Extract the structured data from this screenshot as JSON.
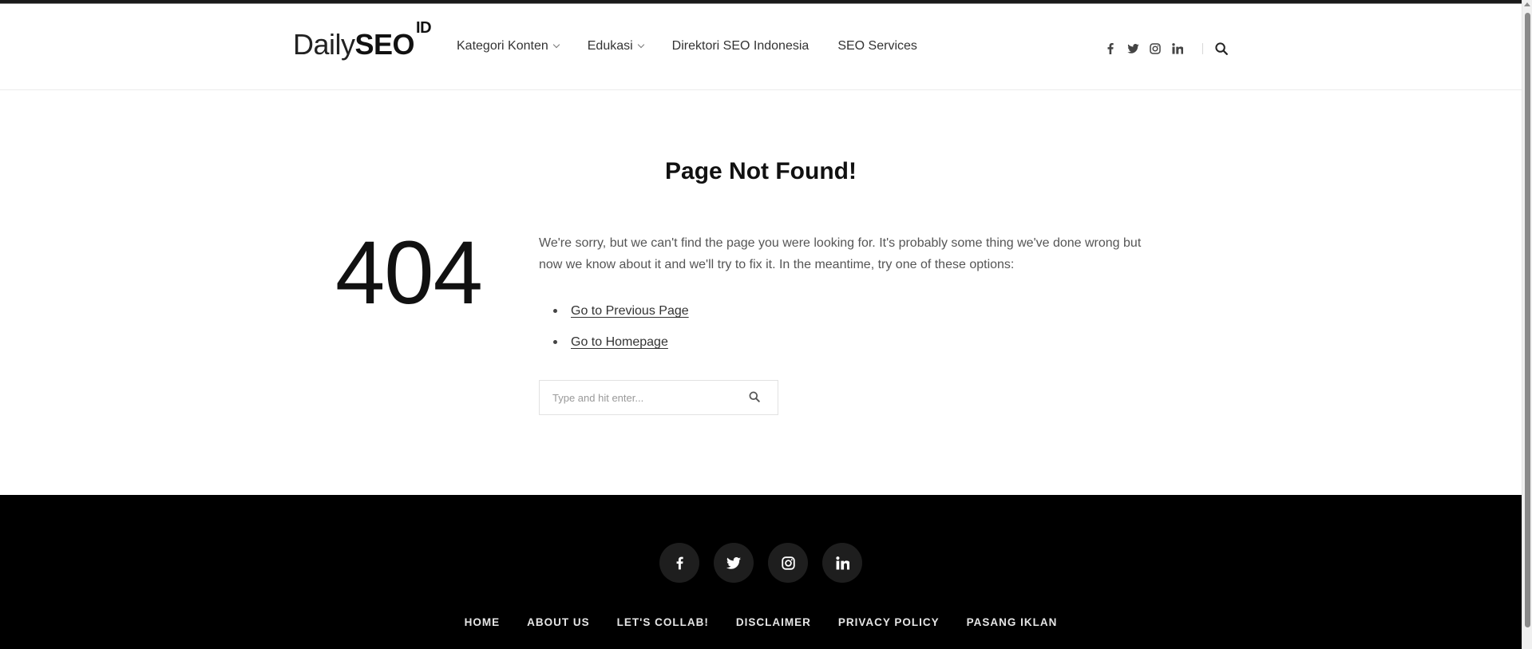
{
  "brand": {
    "logo_part1": "Daily",
    "logo_part2": "SEO",
    "logo_sup": "ID"
  },
  "nav": {
    "items": [
      {
        "label": "Kategori Konten",
        "has_dropdown": true
      },
      {
        "label": "Edukasi",
        "has_dropdown": true
      },
      {
        "label": "Direktori SEO Indonesia",
        "has_dropdown": false
      },
      {
        "label": "SEO Services",
        "has_dropdown": false
      }
    ]
  },
  "header_social": [
    "facebook-icon",
    "twitter-icon",
    "instagram-icon",
    "linkedin-icon"
  ],
  "content": {
    "title": "Page Not Found!",
    "code": "404",
    "message": "We're sorry, but we can't find the page you were looking for. It's probably some thing we've done wrong but now we know about it and we'll try to fix it. In the meantime, try one of these options:",
    "options": [
      "Go to Previous Page",
      "Go to Homepage"
    ],
    "search_placeholder": "Type and hit enter..."
  },
  "footer": {
    "social": [
      "facebook-icon",
      "twitter-icon",
      "instagram-icon",
      "linkedin-icon"
    ],
    "menu": [
      "HOME",
      "ABOUT US",
      "LET'S COLLAB!",
      "DISCLAIMER",
      "PRIVACY POLICY",
      "PASANG IKLAN"
    ]
  },
  "colors": {
    "footer_bg": "#000000",
    "social_button_bg": "#1e1e1e",
    "text_dark": "#111111",
    "text_muted": "#555555"
  }
}
